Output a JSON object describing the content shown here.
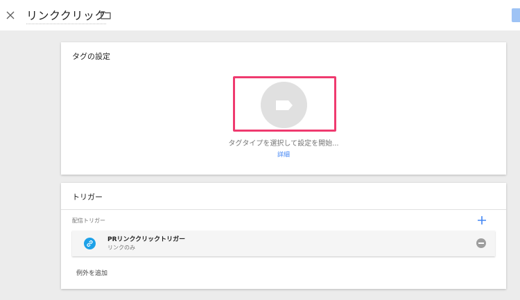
{
  "header": {
    "title": "リンククリック",
    "close_icon": "close-icon",
    "folder_icon": "folder-icon"
  },
  "tag_config": {
    "title": "タグの設定",
    "icon": "tag-icon",
    "prompt": "タグタイプを選択して設定を開始...",
    "details_link": "詳細",
    "highlight_color": "#ef3a6f"
  },
  "triggering": {
    "title": "トリガー",
    "firing_label": "配信トリガー",
    "add_icon": "plus-icon",
    "items": [
      {
        "name": "PRリンククリックトリガー",
        "subtitle": "リンクのみ",
        "icon": "link-icon",
        "icon_color": "#1da1e8",
        "remove_icon": "remove-circle-icon"
      }
    ],
    "add_exception_label": "例外を追加"
  },
  "colors": {
    "accent": "#4285f4",
    "background": "#ececec"
  }
}
